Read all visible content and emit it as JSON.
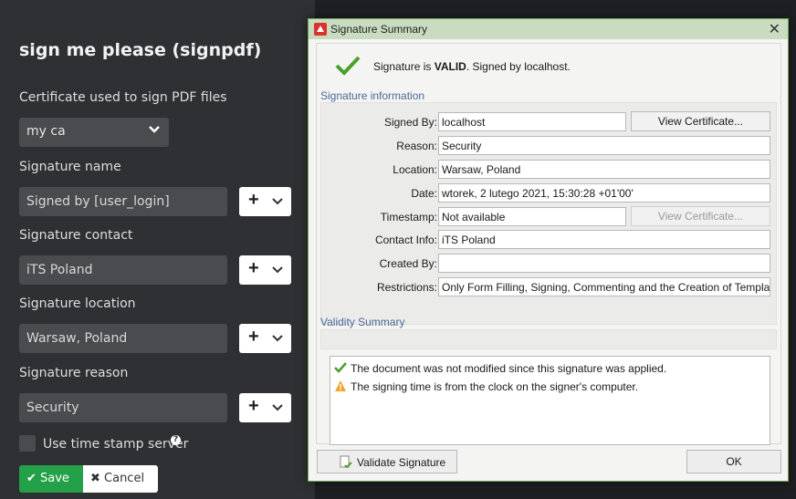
{
  "panel": {
    "title": "sign me please (signpdf)",
    "cert_label": "Certificate used to sign PDF files",
    "cert_value": "my ca",
    "name_label": "Signature name",
    "name_value": "Signed by [user_login]",
    "contact_label": "Signature contact",
    "contact_value": "iTS Poland",
    "location_label": "Signature location",
    "location_value": "Warsaw, Poland",
    "reason_label": "Signature reason",
    "reason_value": "Security",
    "plus_glyph": "+",
    "timestamp_label": "Use time stamp server",
    "help_glyph": "?",
    "save_label": "✔ Save",
    "cancel_label": "✖ Cancel",
    "save_color": "#24a148"
  },
  "dialog": {
    "title": "Signature Summary",
    "close_glyph": "✕",
    "status_prefix": "Signature is ",
    "status_bold": "VALID",
    "status_suffix": ". Signed by localhost.",
    "info_group": "Signature information",
    "fields": {
      "signed_by_label": "Signed By:",
      "signed_by": "localhost",
      "reason_label": "Reason:",
      "reason": "Security",
      "location_label": "Location:",
      "location": "Warsaw, Poland",
      "date_label": "Date:",
      "date": "wtorek, 2 lutego 2021, 15:30:28 +01'00'",
      "timestamp_label": "Timestamp:",
      "timestamp": "Not available",
      "contact_label": "Contact Info:",
      "contact": "iTS Poland",
      "created_by_label": "Created By:",
      "created_by": "",
      "restrictions_label": "Restrictions:",
      "restrictions": "Only Form Filling, Signing, Commenting and the Creation of Template P"
    },
    "view_cert_label": "View Certificate...",
    "validity_group": "Validity Summary",
    "validity_items": [
      {
        "icon": "check-icon",
        "text": "The document was not modified since this signature was applied."
      },
      {
        "icon": "warning-icon",
        "text": "The signing time is from the clock on the signer's computer."
      }
    ],
    "validate_label": "Validate Signature",
    "ok_label": "OK"
  }
}
